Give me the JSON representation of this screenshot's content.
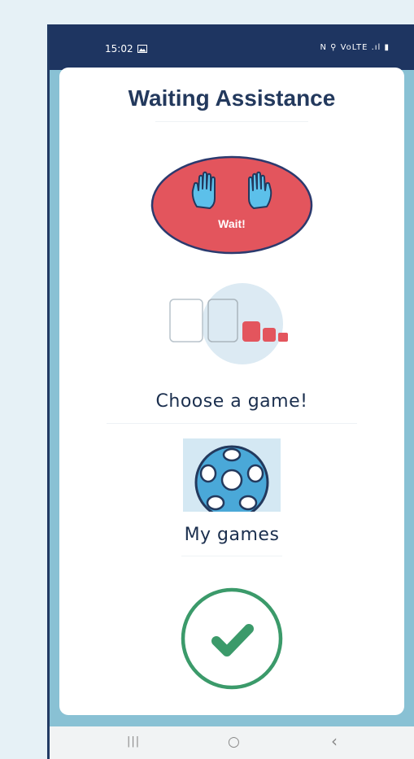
{
  "status_bar": {
    "time": "15:02",
    "system_icons": "N ⚲ VoLTE .ıl ▮"
  },
  "screen": {
    "title": "Waiting Assistance",
    "wait_button": {
      "label": "Wait!",
      "icon": "raised-hands-icon"
    },
    "choose_game_label": "Choose a game!",
    "my_games_label": "My games",
    "confirm_icon": "checkmark-icon"
  },
  "nav_bar": {
    "recents": "|||",
    "home": "○",
    "back": "‹"
  },
  "colors": {
    "navy": "#1e3561",
    "wait_red": "#e3555d",
    "confirm_green": "#3b9a6a",
    "ball_blue": "#4aa8d8",
    "frame": "#89c1d4"
  }
}
